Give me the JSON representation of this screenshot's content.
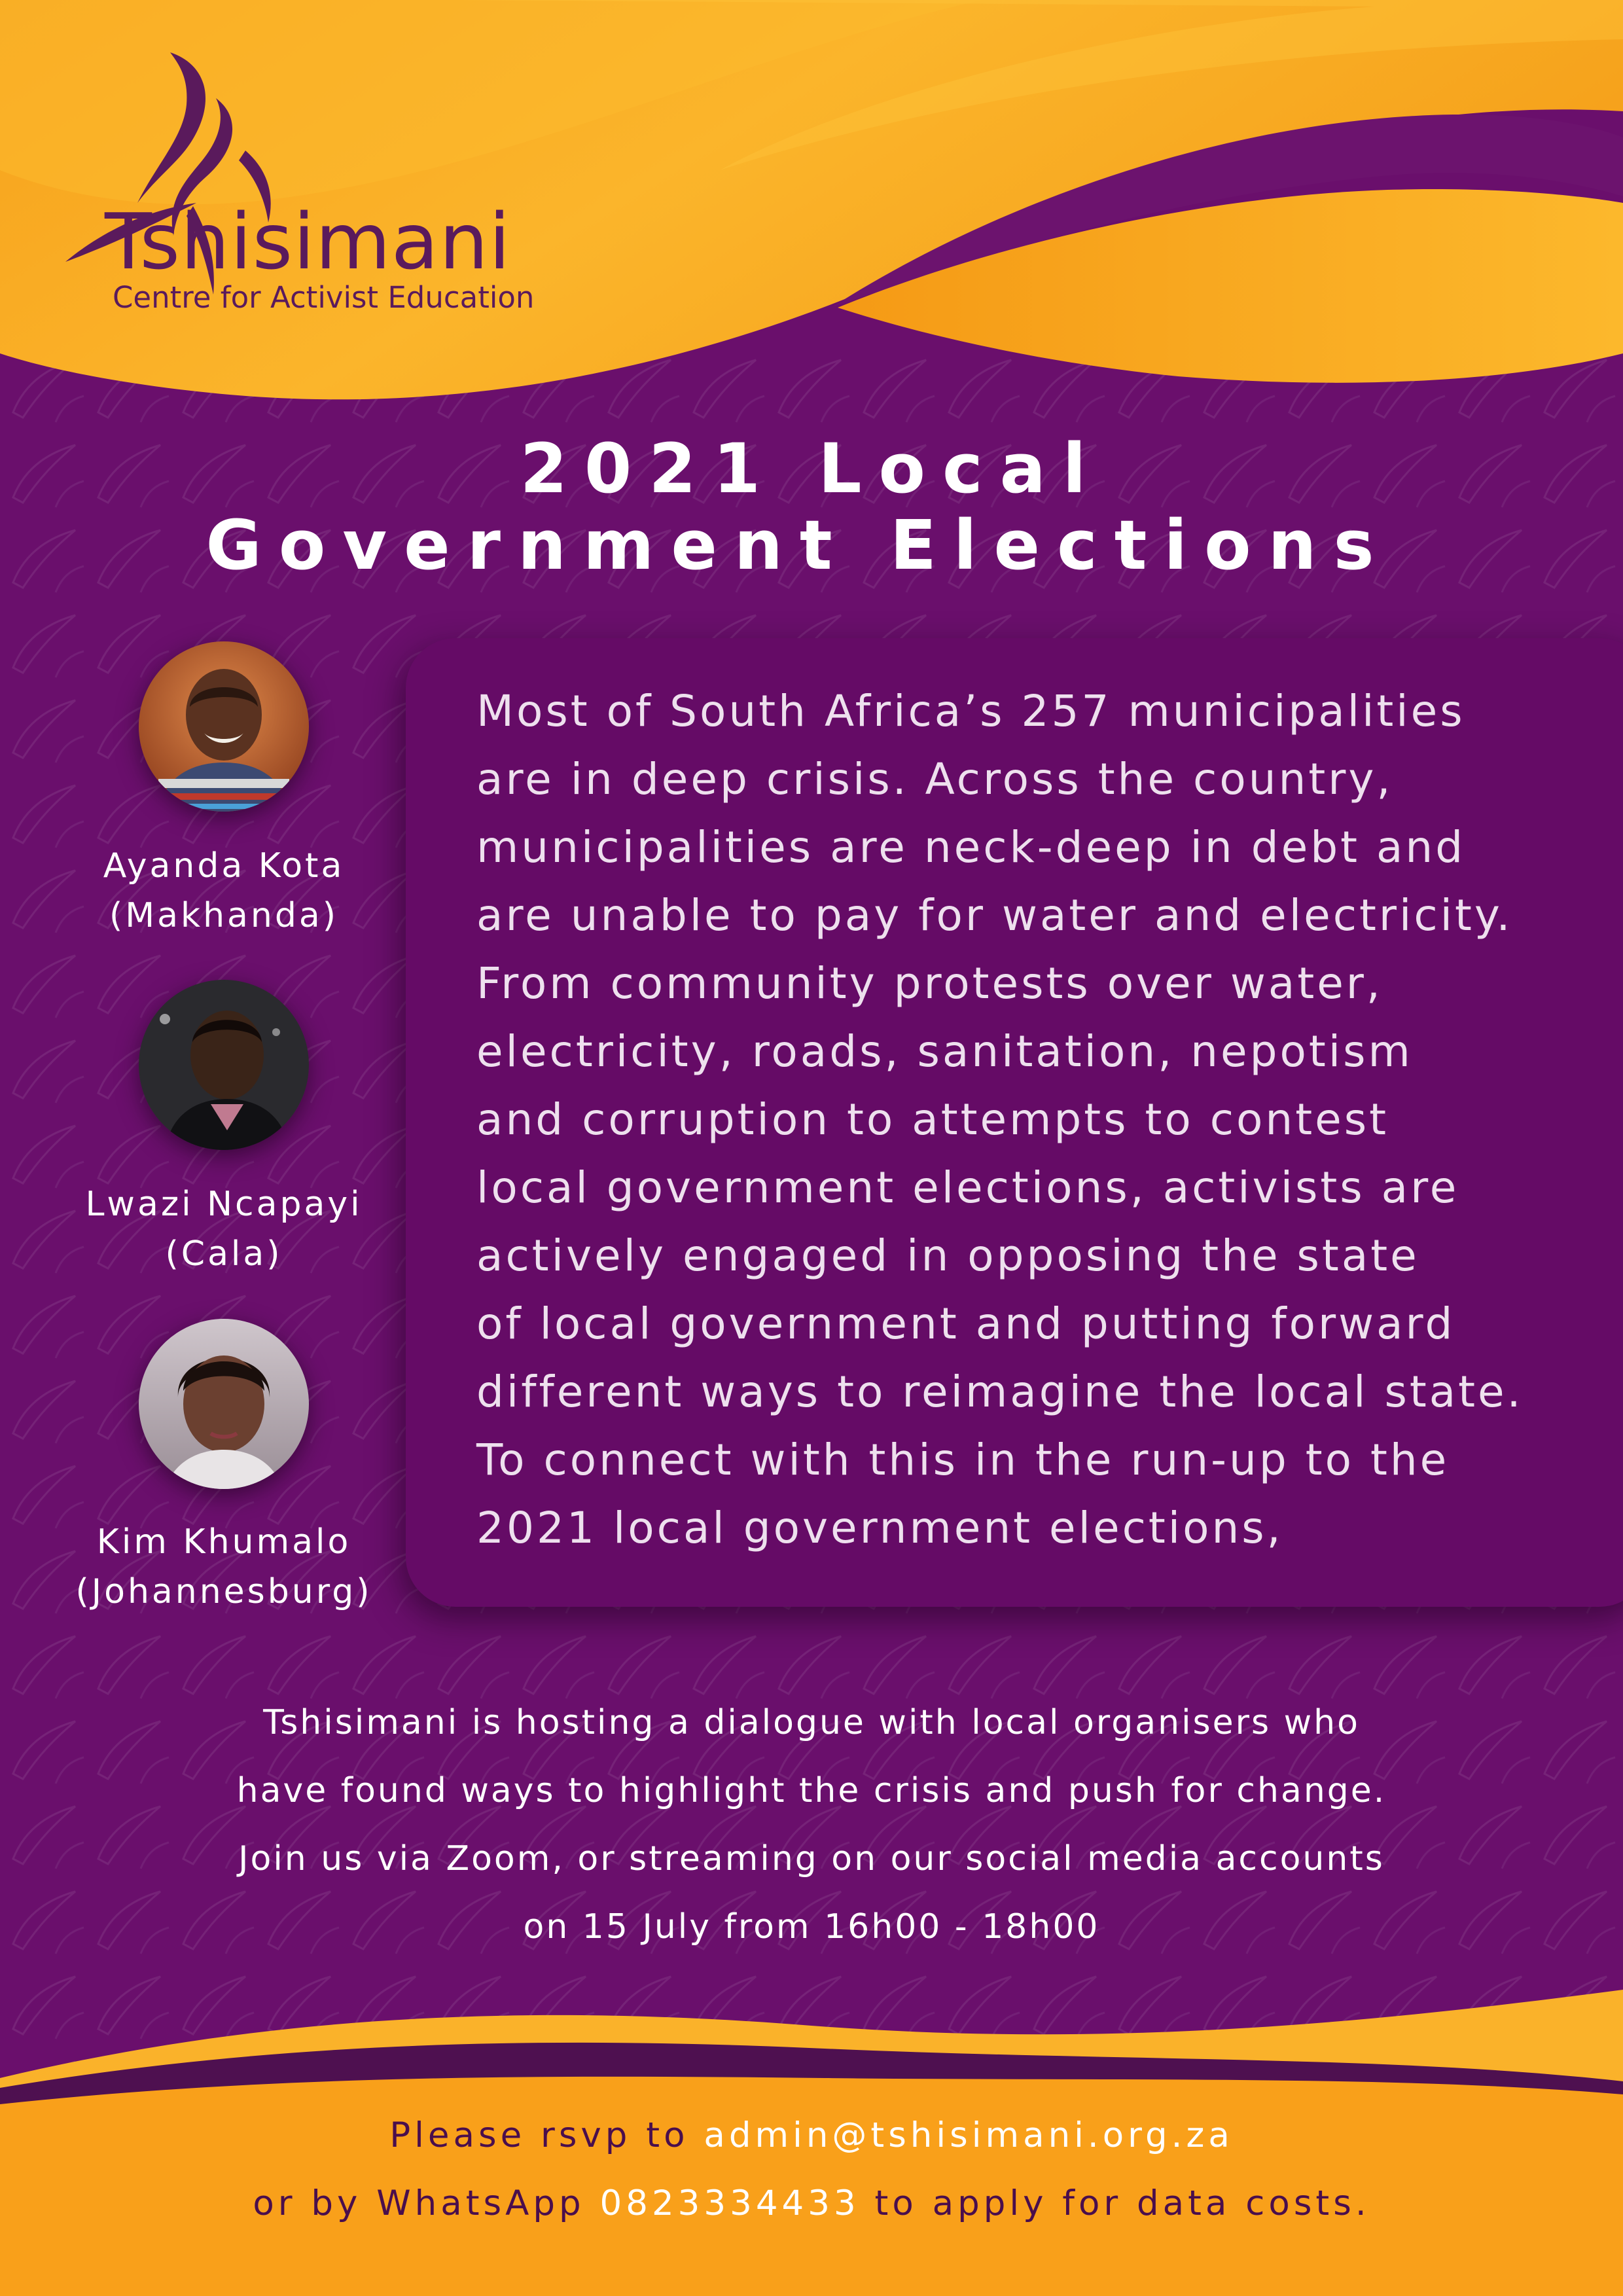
{
  "logo": {
    "name": "Tshisimani",
    "tagline": "Centre for Activist Education"
  },
  "title": {
    "line1": "2021 Local",
    "line2": "Government Elections"
  },
  "speakers": [
    {
      "name": "Ayanda Kota",
      "location": "(Makhanda)"
    },
    {
      "name": "Lwazi Ncapayi",
      "location": "(Cala)"
    },
    {
      "name": "Kim Khumalo",
      "location": "(Johannesburg)"
    }
  ],
  "panel_lines": [
    "Most of South Africa’s 257 municipalities",
    "are in deep crisis. Across the country,",
    "municipalities are neck-deep in debt and",
    "are unable to pay for water and electricity.",
    "From community protests over water,",
    "electricity, roads, sanitation, nepotism",
    "and corruption to attempts to contest",
    "local government elections, activists are",
    "actively engaged  in opposing the state",
    "of local government and putting forward",
    "different ways to reimagine the local state.",
    "To connect with this in the run-up to the",
    "2021 local government elections,"
  ],
  "host_lines": [
    "Tshisimani is hosting a dialogue with local organisers who",
    "have found ways to highlight the crisis and push for change.",
    "Join us via Zoom, or streaming on our social media accounts",
    "on 15 July from 16h00 - 18h00"
  ],
  "rsvp": {
    "prefix": "Please rsvp to ",
    "email": "admin@tshisimani.org.za",
    "line2_prefix": "or by WhatsApp ",
    "phone": "0823334433",
    "line2_suffix": " to apply for data costs."
  },
  "colors": {
    "purple": "#6a0f6c",
    "panel_purple": "#650b66",
    "orange": "#f6a019",
    "gold": "#fbb82a",
    "deep_purple": "#4a0e4c"
  }
}
